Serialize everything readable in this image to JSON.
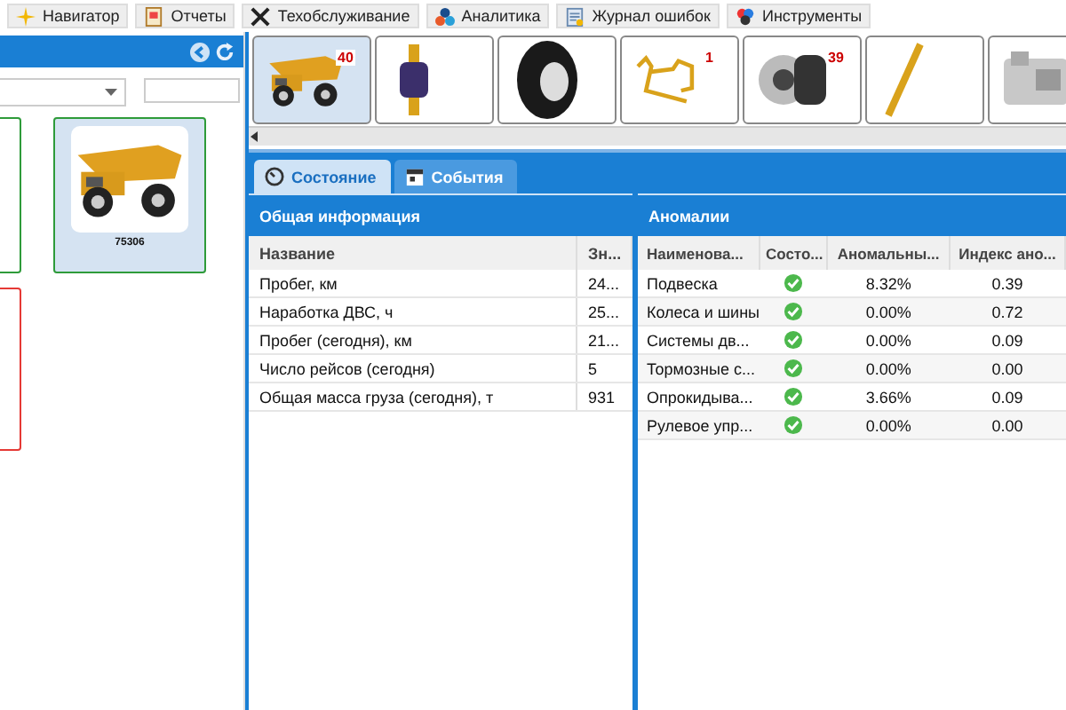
{
  "toolbar": [
    {
      "label": "Навигатор"
    },
    {
      "label": "Отчеты"
    },
    {
      "label": "Техобслуживание"
    },
    {
      "label": "Аналитика"
    },
    {
      "label": "Журнал ошибок"
    },
    {
      "label": "Инструменты"
    }
  ],
  "vehicles": [
    {
      "color": "#2e9b3a",
      "selected": false
    },
    {
      "color": "#2e9b3a",
      "selected": true,
      "label": "75306"
    },
    {
      "color": "#e53935",
      "selected": false
    }
  ],
  "components": [
    {
      "kind": "truck",
      "badge": "40",
      "selected": true
    },
    {
      "kind": "cylinder",
      "selected": false
    },
    {
      "kind": "tire",
      "selected": false
    },
    {
      "kind": "bracket",
      "badge": "1",
      "selected": false
    },
    {
      "kind": "brake",
      "badge": "39",
      "selected": false
    },
    {
      "kind": "rod",
      "selected": false
    },
    {
      "kind": "engine",
      "selected": false
    }
  ],
  "tabs": [
    {
      "label": "Состояние",
      "selected": true
    },
    {
      "label": "События",
      "selected": false
    }
  ],
  "general": {
    "title": "Общая информация",
    "columns": [
      "Название",
      "Зн..."
    ],
    "rows": [
      [
        "Пробег, км",
        "24..."
      ],
      [
        "Наработка ДВС, ч",
        "25..."
      ],
      [
        "Пробег (сегодня), км",
        "21..."
      ],
      [
        "Число рейсов (сегодня)",
        "5"
      ],
      [
        "Общая масса груза (сегодня), т",
        "931"
      ]
    ]
  },
  "anomalies": {
    "title": "Аномалии",
    "columns": [
      "Наименова...",
      "Состо...",
      "Аномальны...",
      "Индекс ано..."
    ],
    "rows": [
      {
        "name": "Подвеска",
        "ok": true,
        "share": "8.32%",
        "index": "0.39"
      },
      {
        "name": "Колеса и шины",
        "ok": true,
        "share": "0.00%",
        "index": "0.72"
      },
      {
        "name": "Системы дв...",
        "ok": true,
        "share": "0.00%",
        "index": "0.09"
      },
      {
        "name": "Тормозные с...",
        "ok": true,
        "share": "0.00%",
        "index": "0.00"
      },
      {
        "name": "Опрокидыва...",
        "ok": true,
        "share": "3.66%",
        "index": "0.09"
      },
      {
        "name": "Рулевое упр...",
        "ok": true,
        "share": "0.00%",
        "index": "0.00"
      }
    ]
  }
}
